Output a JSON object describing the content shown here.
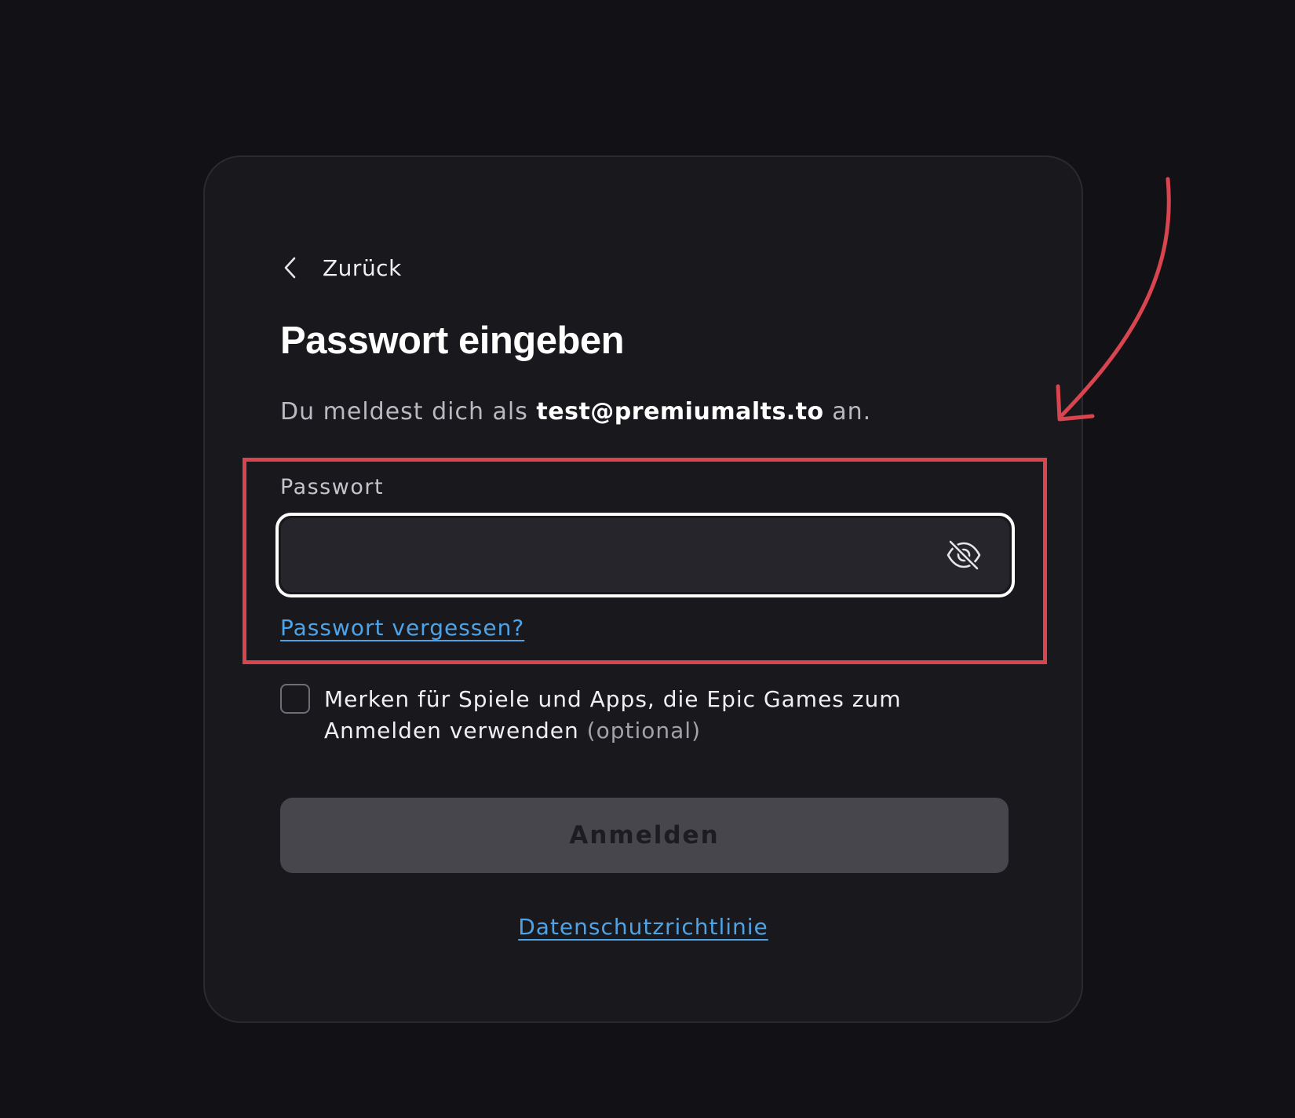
{
  "colors": {
    "page_background": "#111116",
    "card_background": "#18181d",
    "input_background": "#25252b",
    "link": "#4ea3e6",
    "button_disabled": "#46464c",
    "annotation": "#d8454f"
  },
  "nav": {
    "back_label": "Zurück",
    "back_icon": "chevron-left-icon"
  },
  "form": {
    "title": "Passwort eingeben",
    "subtitle_prefix": "Du meldest dich als",
    "email": "test@premiumalts.to",
    "subtitle_suffix": "an.",
    "password_label": "Passwort",
    "password_value": "",
    "password_visibility_icon": "eye-off-icon",
    "forgot_password": "Passwort vergessen?",
    "remember_checked": false,
    "remember_label": "Merken für Spiele und Apps, die Epic Games zum Anmelden verwenden",
    "remember_optional": "(optional)",
    "submit_label": "Anmelden",
    "privacy_link": "Datenschutzrichtlinie"
  }
}
